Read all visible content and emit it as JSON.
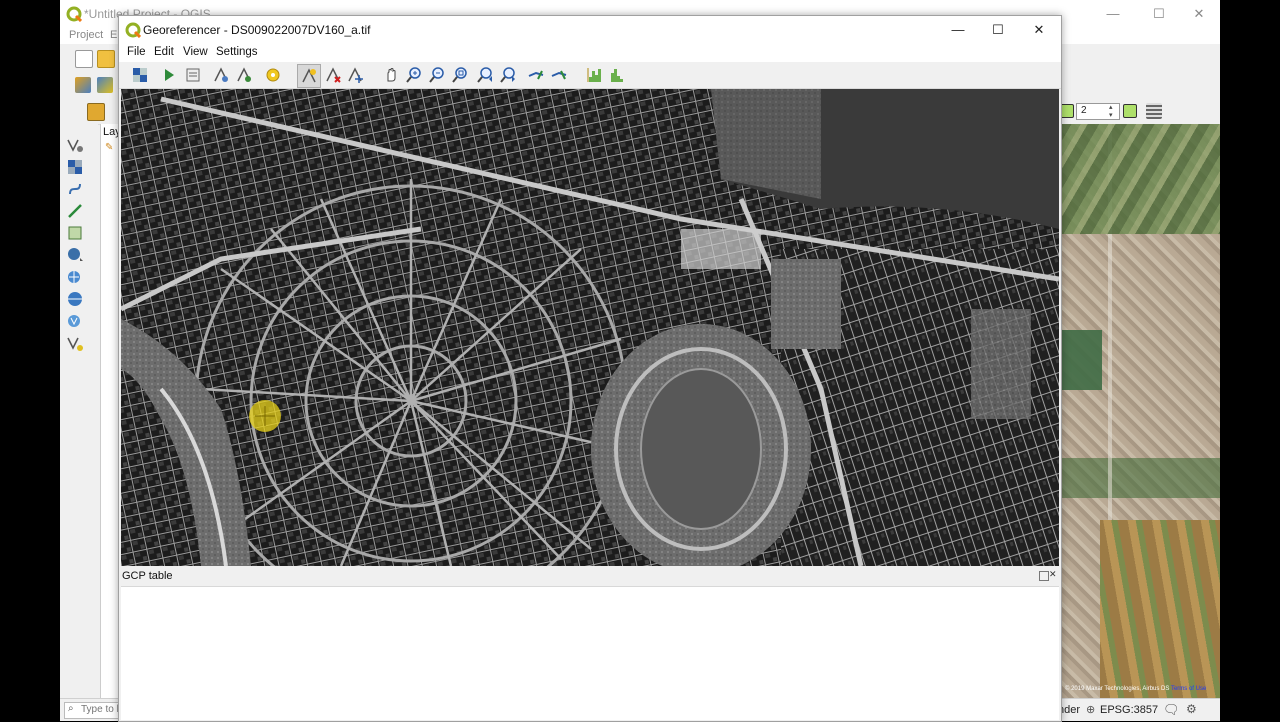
{
  "main_window": {
    "title": "*Untitled Project - QGIS",
    "menu": [
      "Project",
      "E"
    ],
    "pager": {
      "value": "2"
    },
    "layers_label": "Lay",
    "search_placeholder": "Type to l",
    "status": {
      "render_label": "nder",
      "crs": "EPSG:3857"
    },
    "map_attribution": {
      "text": "© 2019 Maxar Technologies, Airbus DS",
      "link": "Terms of Use"
    }
  },
  "georeferencer": {
    "title": "Georeferencer - DS009022007DV160_a.tif",
    "menu": [
      "File",
      "Edit",
      "View",
      "Settings"
    ],
    "toolbar_icons": [
      "open-raster-icon",
      "start-georeferencing-icon",
      "generate-gdal-script-icon",
      "load-gcp-icon",
      "save-gcp-icon",
      "transformation-settings-icon",
      "add-point-icon",
      "delete-point-icon",
      "move-point-icon",
      "pan-icon",
      "zoom-in-icon",
      "zoom-out-icon",
      "zoom-to-layer-icon",
      "zoom-last-icon",
      "zoom-next-icon",
      "link-georeferencer-icon",
      "link-qgis-icon",
      "local-histogram-stretch-icon",
      "full-histogram-stretch-icon"
    ],
    "gcp_table_label": "GCP table"
  },
  "colors": {
    "accent_green": "#6ab04c",
    "gcp_marker": "#e8d21a"
  }
}
